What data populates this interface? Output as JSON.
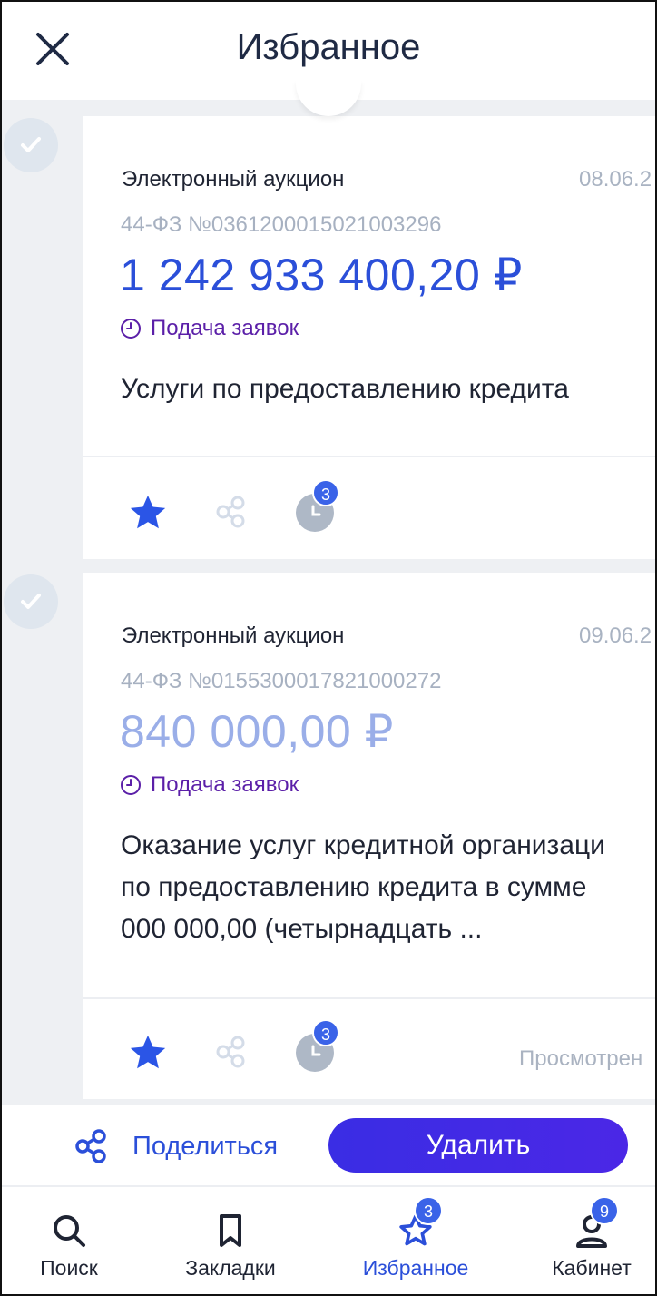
{
  "header": {
    "title": "Избранное"
  },
  "cards": [
    {
      "procedure_type": "Электронный аукцион",
      "date": "08.06.2",
      "registry_number": "44-ФЗ №0361200015021003296",
      "price": "1 242 933 400,20 ₽",
      "status": "Подача заявок",
      "description_lines": [
        "Услуги по предоставлению кредита"
      ],
      "history_count": "3",
      "viewed_label": ""
    },
    {
      "procedure_type": "Электронный аукцион",
      "date": "09.06.2",
      "registry_number": "44-ФЗ №0155300017821000272",
      "price": "840 000,00 ₽",
      "status": "Подача заявок",
      "description_lines": [
        "Оказание услуг кредитной организаци",
        "по предоставлению кредита в сумме",
        "000 000,00 (четырнадцать  ..."
      ],
      "history_count": "3",
      "viewed_label": "Просмотрен"
    }
  ],
  "action_bar": {
    "share_label": "Поделиться",
    "delete_label": "Удалить"
  },
  "tabbar": {
    "tabs": [
      {
        "label": "Поиск",
        "icon": "search-icon",
        "badge": ""
      },
      {
        "label": "Закладки",
        "icon": "bookmark-icon",
        "badge": ""
      },
      {
        "label": "Избранное",
        "icon": "star-icon",
        "badge": "3",
        "active": true
      },
      {
        "label": "Кабинет",
        "icon": "user-icon",
        "badge": "9"
      }
    ]
  },
  "colors": {
    "accent": "#2b4fd9",
    "status_purple": "#5b1fa8",
    "delete_button": "#3a2de4",
    "muted_price": "#9aaee8"
  }
}
